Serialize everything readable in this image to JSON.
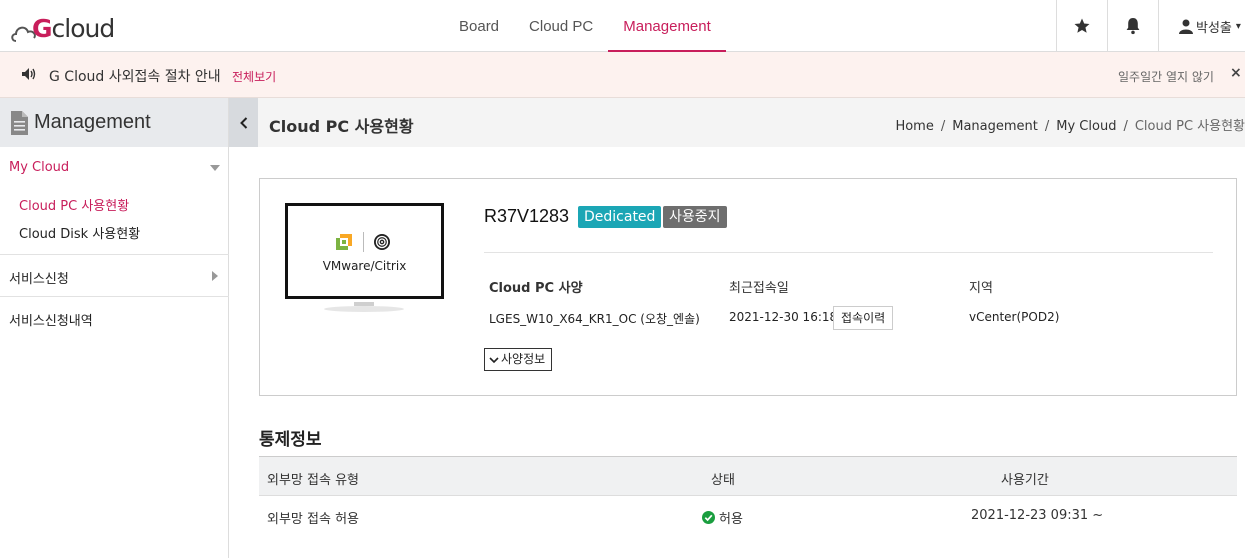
{
  "header": {
    "logo": "Gcloud",
    "nav": [
      {
        "label": "Board",
        "active": false
      },
      {
        "label": "Cloud PC",
        "active": false
      },
      {
        "label": "Management",
        "active": true
      }
    ],
    "favorites_icon": "star-icon",
    "notifications_icon": "bell-icon",
    "user_name": "박성출"
  },
  "notice": {
    "text": "G Cloud 사외접속 절차 안내",
    "link": "전체보기",
    "hide_week": "일주일간 열지 않기",
    "close": "×"
  },
  "sidebar": {
    "title": "Management",
    "mycloud": {
      "label": "My Cloud",
      "items": [
        {
          "label": "Cloud PC 사용현황",
          "active": true
        },
        {
          "label": "Cloud Disk 사용현황",
          "active": false
        }
      ]
    },
    "service_request": "서비스신청",
    "service_history": "서비스신청내역"
  },
  "page": {
    "title": "Cloud PC 사용현황",
    "breadcrumb": [
      "Home",
      "Management",
      "My Cloud",
      "Cloud PC 사용현황"
    ]
  },
  "pc": {
    "platform_label": "VMware/Citrix",
    "name": "R37V1283",
    "type_badge": "Dedicated",
    "status_badge": "사용중지",
    "columns": {
      "spec": {
        "header": "Cloud PC 사양",
        "value": "LGES_W10_X64_KR1_OC (오창_엔솔)"
      },
      "last_access": {
        "header": "최근접속일",
        "value": "2021-12-30 16:18",
        "button": "접속이력"
      },
      "region": {
        "header": "지역",
        "value": "vCenter(POD2)"
      }
    },
    "spec_button": "사양정보"
  },
  "control": {
    "title": "통제정보",
    "headers": [
      "외부망 접속 유형",
      "상태",
      "사용기간"
    ],
    "rows": [
      {
        "type": "외부망 접속 허용",
        "status": "허용",
        "period": "2021-12-23 09:31 ~"
      }
    ]
  },
  "colors": {
    "accent": "#c81e5b",
    "dedicated": "#1ba6b5",
    "stopped": "#6e6e6e",
    "ok": "#1a9e3f"
  }
}
